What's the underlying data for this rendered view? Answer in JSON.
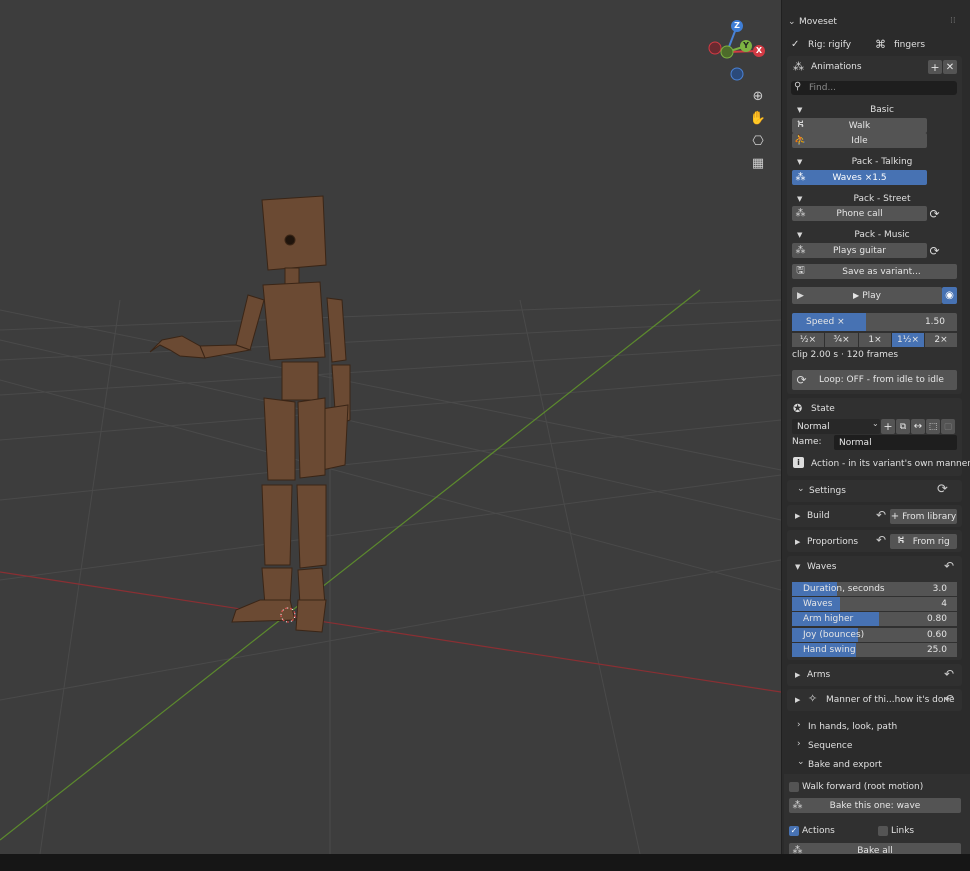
{
  "viewport": {
    "gizmo": {
      "z": "Z",
      "y": "Y",
      "x": "X"
    },
    "tools": [
      "zoom-icon",
      "hand-icon",
      "camera-icon",
      "grid-icon"
    ]
  },
  "panel": {
    "title": "Moveset",
    "rig_label": "Rig: rigify",
    "fingers_label": "fingers",
    "animations": {
      "title": "Animations",
      "search_placeholder": "Find...",
      "groups": [
        {
          "title": "Basic",
          "items": [
            "Walk",
            "Idle"
          ]
        },
        {
          "title": "Pack - Talking",
          "items": [
            "Waves  ×1.5"
          ]
        },
        {
          "title": "Pack - Street",
          "items": [
            "Phone call"
          ]
        },
        {
          "title": "Pack - Music",
          "items": [
            "Plays guitar"
          ]
        }
      ],
      "save_variant": "Save as variant...",
      "play": "Play",
      "speed_label": "Speed ×",
      "speed_value": "1.50",
      "speed_fraction": 0.45,
      "speed_presets": [
        "½×",
        "¾×",
        "1×",
        "1½×",
        "2×"
      ],
      "speed_active": "1½×",
      "clip_info": "clip 2.00 s · 120 frames",
      "loop": "Loop: OFF - from idle to idle"
    },
    "state": {
      "title": "State",
      "selected": "Normal",
      "name_label": "Name:",
      "name_value": "Normal",
      "action_info": "Action - in its variant's own manner"
    },
    "settings": {
      "title": "Settings",
      "build": "Build",
      "from_library": "From library",
      "proportions": "Proportions",
      "from_rig": "From rig",
      "waves": {
        "title": "Waves",
        "sliders": [
          {
            "name": "Duration, seconds",
            "value": "3.0",
            "fraction": 0.27
          },
          {
            "name": "Waves",
            "value": "4",
            "fraction": 0.29
          },
          {
            "name": "Arm higher",
            "value": "0.80",
            "fraction": 0.53
          },
          {
            "name": "Joy (bounces)",
            "value": "0.60",
            "fraction": 0.4
          },
          {
            "name": "Hand swing",
            "value": "25.0",
            "fraction": 0.39
          }
        ]
      },
      "arms": "Arms",
      "manner": "Manner of thi...how it's done"
    },
    "collapsed": [
      "In hands, look, path",
      "Sequence"
    ],
    "bake": {
      "title": "Bake and export",
      "walk_forward": "Walk forward (root motion)",
      "bake_one": "Bake this one: wave",
      "actions": "Actions",
      "links": "Links",
      "bake_all": "Bake all"
    }
  }
}
